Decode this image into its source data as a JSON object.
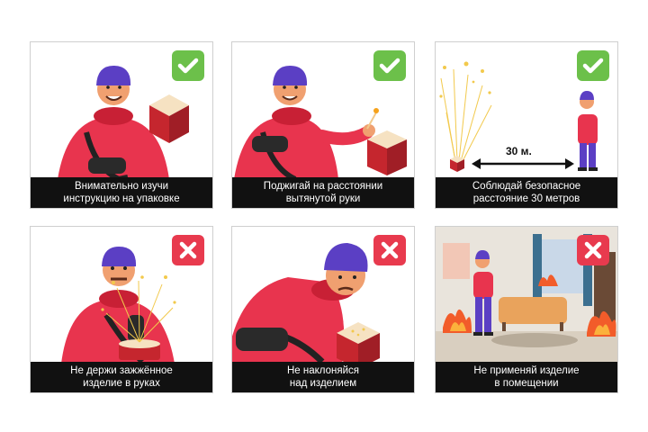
{
  "colors": {
    "ok_badge": "#6cc04a",
    "no_badge": "#e83a4e",
    "caption_bg": "#111111",
    "caption_text": "#ffffff",
    "hoodie": "#e8344e",
    "hat": "#5b3fc4"
  },
  "panels": [
    {
      "status": "check-icon",
      "caption_line1": "Внимательно изучи",
      "caption_line2": "инструкцию на упаковке"
    },
    {
      "status": "check-icon",
      "caption_line1": "Поджигай на расстоянии",
      "caption_line2": "вытянутой руки"
    },
    {
      "status": "check-icon",
      "caption_line1": "Соблюдай безопасное",
      "caption_line2": "расстояние 30 метров",
      "distance_label": "30 м."
    },
    {
      "status": "cross-icon",
      "caption_line1": "Не держи зажжённое",
      "caption_line2": "изделие в руках"
    },
    {
      "status": "cross-icon",
      "caption_line1": "Не наклоняйся",
      "caption_line2": "над изделием"
    },
    {
      "status": "cross-icon",
      "caption_line1": "Не применяй изделие",
      "caption_line2": "в помещении"
    }
  ]
}
